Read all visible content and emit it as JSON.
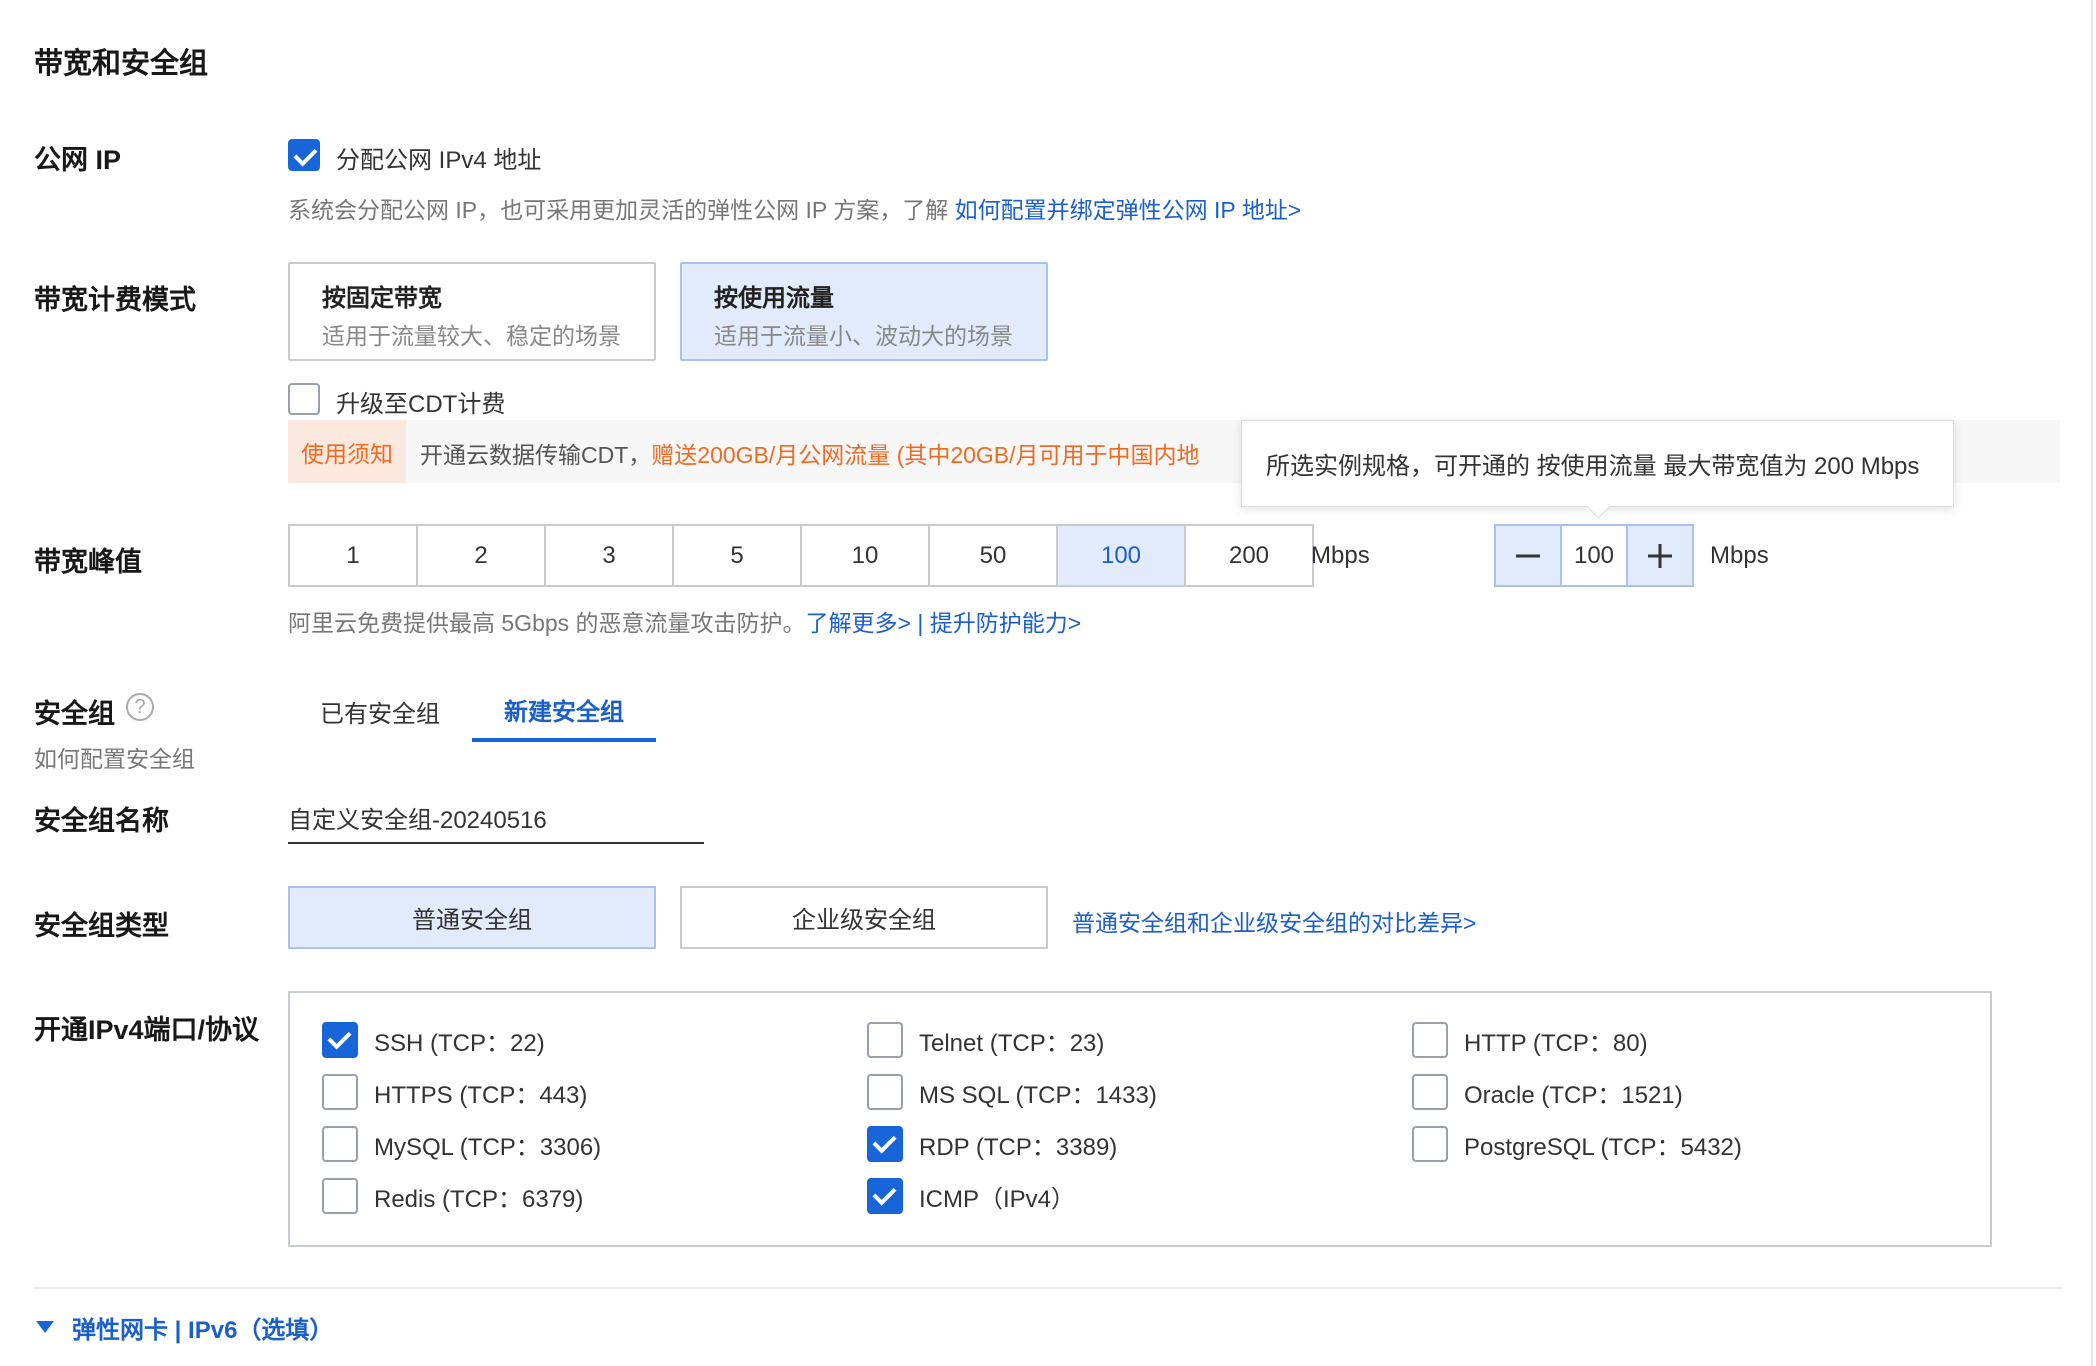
{
  "section_title": "带宽和安全组",
  "public_ip": {
    "label": "公网 IP",
    "checkbox_label": "分配公网 IPv4 地址",
    "checked": true,
    "hint": "系统会分配公网 IP，也可采用更加灵活的弹性公网 IP 方案，了解 ",
    "hint_link": "如何配置并绑定弹性公网 IP 地址>"
  },
  "billing": {
    "label": "带宽计费模式",
    "options": [
      {
        "title": "按固定带宽",
        "subtitle": "适用于流量较大、稳定的场景",
        "selected": false
      },
      {
        "title": "按使用流量",
        "subtitle": "适用于流量小、波动大的场景",
        "selected": true
      }
    ],
    "cdt_label": "升级至CDT计费",
    "cdt_checked": false,
    "notice_tag": "使用须知",
    "notice_text": "开通云数据传输CDT，",
    "notice_highlight": "赠送200GB/月公网流量 (其中20GB/月可用于中国内地"
  },
  "tooltip": {
    "text": "所选实例规格，可开通的 按使用流量 最大带宽值为 200 Mbps"
  },
  "bandwidth": {
    "label": "带宽峰值",
    "options": [
      "1",
      "2",
      "3",
      "5",
      "10",
      "50",
      "100",
      "200"
    ],
    "selected": "100",
    "unit": "Mbps",
    "value": "100",
    "stepper_unit": "Mbps",
    "hint": "阿里云免费提供最高 5Gbps 的恶意流量攻击防护。",
    "link_more": "了解更多>",
    "separator": "|",
    "link_upgrade": "提升防护能力>"
  },
  "security_group": {
    "label": "安全组",
    "help_link": "如何配置安全组",
    "tabs": [
      {
        "label": "已有安全组",
        "active": false
      },
      {
        "label": "新建安全组",
        "active": true
      }
    ],
    "name_label": "安全组名称",
    "name_value": "自定义安全组-20240516",
    "type_label": "安全组类型",
    "types": [
      {
        "label": "普通安全组",
        "selected": true
      },
      {
        "label": "企业级安全组",
        "selected": false
      }
    ],
    "type_compare_link": "普通安全组和企业级安全组的对比差异>"
  },
  "ports": {
    "label": "开通IPv4端口/协议",
    "items": [
      {
        "label": "SSH (TCP：22)",
        "checked": true
      },
      {
        "label": "Telnet (TCP：23)",
        "checked": false
      },
      {
        "label": "HTTP (TCP：80)",
        "checked": false
      },
      {
        "label": "HTTPS (TCP：443)",
        "checked": false
      },
      {
        "label": "MS SQL (TCP：1433)",
        "checked": false
      },
      {
        "label": "Oracle (TCP：1521)",
        "checked": false
      },
      {
        "label": "MySQL (TCP：3306)",
        "checked": false
      },
      {
        "label": "RDP (TCP：3389)",
        "checked": true
      },
      {
        "label": "PostgreSQL (TCP：5432)",
        "checked": false
      },
      {
        "label": "Redis (TCP：6379)",
        "checked": false
      },
      {
        "label": "ICMP（IPv4）",
        "checked": true
      }
    ]
  },
  "footer": {
    "expand_label": "弹性网卡 | IPv6（选填）"
  },
  "colors": {
    "accent": "#1765d8",
    "link": "#1b5fc9",
    "selected_bg": "#e2ebfb",
    "notice_orange": "#ee6b22"
  }
}
